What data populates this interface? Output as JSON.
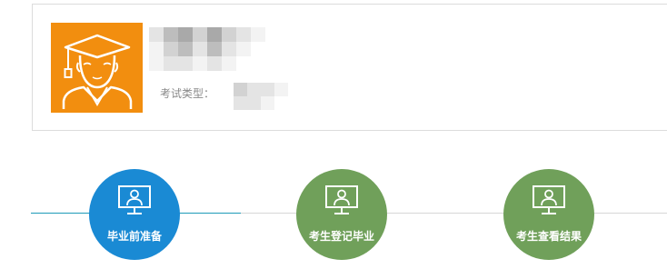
{
  "colors": {
    "avatar_background": "#f28e0f",
    "step_active": "#1a8ad4",
    "step_inactive": "#70a05a",
    "progress_active": "#1d9bb8",
    "progress_inactive": "#d6d6d6",
    "card_border": "#dcdcdc"
  },
  "profile": {
    "avatar_icon": "graduate-avatar-icon",
    "name_redacted": true,
    "exam_type_label": "考试类型：",
    "exam_type_value_redacted": true
  },
  "progress": {
    "completed_fraction": 0.33,
    "steps": [
      {
        "label": "毕业前准备",
        "icon": "monitor-user-icon",
        "state": "active"
      },
      {
        "label": "考生登记毕业",
        "icon": "monitor-user-icon",
        "state": "inactive"
      },
      {
        "label": "考生查看结果",
        "icon": "monitor-user-icon",
        "state": "inactive"
      }
    ]
  }
}
